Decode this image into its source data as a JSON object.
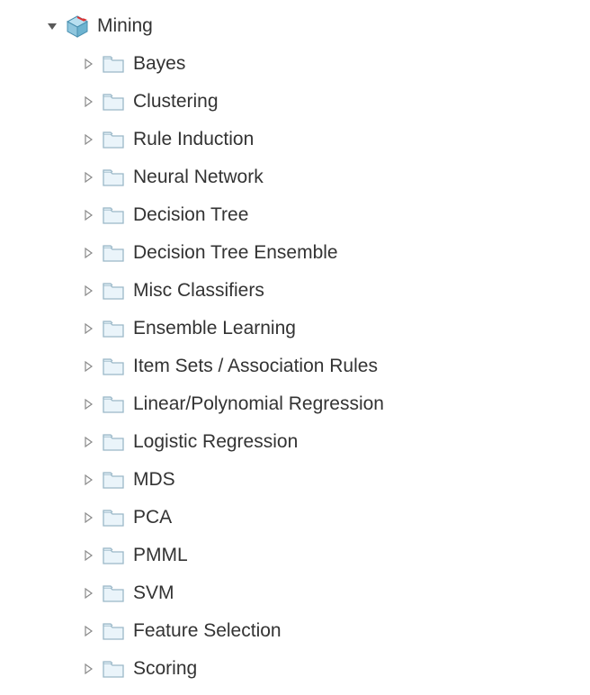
{
  "tree": {
    "root": {
      "label": "Mining",
      "icon": "cube-icon",
      "expanded": true
    },
    "children": [
      {
        "label": "Bayes"
      },
      {
        "label": "Clustering"
      },
      {
        "label": "Rule Induction"
      },
      {
        "label": "Neural Network"
      },
      {
        "label": "Decision Tree"
      },
      {
        "label": "Decision Tree Ensemble"
      },
      {
        "label": "Misc Classifiers"
      },
      {
        "label": "Ensemble Learning"
      },
      {
        "label": "Item Sets / Association Rules"
      },
      {
        "label": "Linear/Polynomial Regression"
      },
      {
        "label": "Logistic Regression"
      },
      {
        "label": "MDS"
      },
      {
        "label": "PCA"
      },
      {
        "label": "PMML"
      },
      {
        "label": "SVM"
      },
      {
        "label": "Feature Selection"
      },
      {
        "label": "Scoring"
      }
    ]
  }
}
